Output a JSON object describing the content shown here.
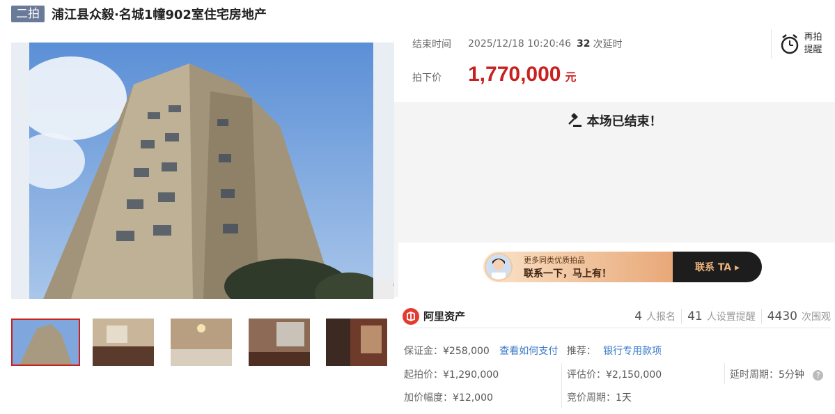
{
  "header": {
    "badge": "二拍",
    "title": "浦江县众毅·名城1幢902室住宅房地产"
  },
  "auction": {
    "end_time_label": "结束时间",
    "end_time": "2025/12/18 10:20:46",
    "delay_count": "32",
    "delay_unit": "次延时",
    "price_label": "拍下价",
    "price": "1,770,000",
    "price_unit": "元",
    "remind_line1": "再拍",
    "remind_line2": "提醒",
    "ended_message": "本场已结束！"
  },
  "promo": {
    "line1": "更多同类优质拍品",
    "line2": "联系一下，马上有！",
    "cta": "联系 TA ▸"
  },
  "brand": {
    "name": "阿里资产"
  },
  "stats": [
    {
      "num": "4",
      "label": "人报名"
    },
    {
      "num": "41",
      "label": "人设置提醒"
    },
    {
      "num": "4430",
      "label": "次围观"
    }
  ],
  "details": {
    "deposit_label": "保证金：",
    "deposit": "¥258,000",
    "pay_link": "查看如何支付",
    "recommend_label": "推荐：",
    "recommend_link": "银行专用款项",
    "start_price_label": "起拍价：",
    "start_price": "¥1,290,000",
    "assess_label": "评估价：",
    "assess": "¥2,150,000",
    "delay_period_label": "延时周期：",
    "delay_period": "5分钟",
    "increment_label": "加价幅度：",
    "increment": "¥12,000",
    "bid_period_label": "竞价周期：",
    "bid_period": "1天"
  },
  "colors": {
    "accent_red": "#c9211f",
    "link_blue": "#3878c9",
    "badge": "#6b7a99"
  }
}
